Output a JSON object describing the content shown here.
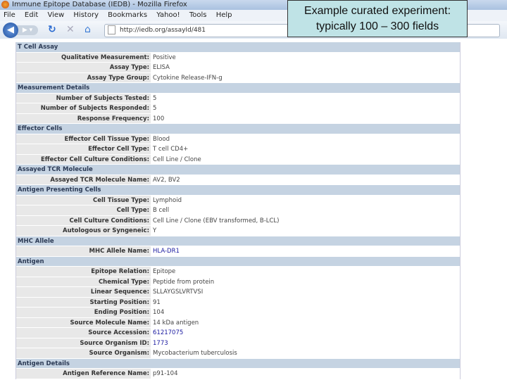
{
  "window_title": "Immune Epitope Database (IEDB) - Mozilla Firefox",
  "menu": [
    "File",
    "Edit",
    "View",
    "History",
    "Bookmarks",
    "Yahoo!",
    "Tools",
    "Help"
  ],
  "url": "http://iedb.org/assayId/481",
  "callout": {
    "line1": "Example curated experiment:",
    "line2": "typically 100 – 300 fields"
  },
  "sections": [
    {
      "title": "T Cell Assay",
      "rows": [
        {
          "label": "Qualitative Measurement:",
          "value": "Positive"
        },
        {
          "label": "Assay Type:",
          "value": "ELISA"
        },
        {
          "label": "Assay Type Group:",
          "value": "Cytokine Release-IFN-g"
        }
      ]
    },
    {
      "title": "Measurement Details",
      "rows": [
        {
          "label": "Number of Subjects Tested:",
          "value": "5"
        },
        {
          "label": "Number of Subjects Responded:",
          "value": "5"
        },
        {
          "label": "Response Frequency:",
          "value": "100"
        }
      ]
    },
    {
      "title": "Effector Cells",
      "rows": [
        {
          "label": "Effector Cell Tissue Type:",
          "value": "Blood"
        },
        {
          "label": "Effector Cell Type:",
          "value": "T cell CD4+"
        },
        {
          "label": "Effector Cell Culture Conditions:",
          "value": "Cell Line / Clone"
        }
      ]
    },
    {
      "title": "Assayed TCR Molecule",
      "rows": [
        {
          "label": "Assayed TCR Molecule Name:",
          "value": "AV2, BV2"
        }
      ]
    },
    {
      "title": "Antigen Presenting Cells",
      "rows": [
        {
          "label": "Cell Tissue Type:",
          "value": "Lymphoid"
        },
        {
          "label": "Cell Type:",
          "value": "B cell"
        },
        {
          "label": "Cell Culture Conditions:",
          "value": "Cell Line / Clone (EBV transformed, B-LCL)"
        },
        {
          "label": "Autologous or Syngeneic:",
          "value": "Y"
        }
      ]
    },
    {
      "title": "MHC Allele",
      "rows": [
        {
          "label": "MHC Allele Name:",
          "value": "HLA-DR1",
          "link": true
        }
      ]
    },
    {
      "title": "Antigen",
      "rows": [
        {
          "label": "Epitope Relation:",
          "value": "Epitope"
        },
        {
          "label": "Chemical Type:",
          "value": "Peptide from protein"
        },
        {
          "label": "Linear Sequence:",
          "value": "SLLAYGSLVRTVSI"
        },
        {
          "label": "Starting Position:",
          "value": "91"
        },
        {
          "label": "Ending Position:",
          "value": "104"
        },
        {
          "label": "Source Molecule Name:",
          "value": "14 kDa antigen"
        },
        {
          "label": "Source Accession:",
          "value": "61217075",
          "link": true
        },
        {
          "label": "Source Organism ID:",
          "value": "1773",
          "link": true
        },
        {
          "label": "Source Organism:",
          "value": "Mycobacterium tuberculosis"
        }
      ]
    },
    {
      "title": "Antigen Details",
      "rows": [
        {
          "label": "Antigen Reference Name:",
          "value": "p91-104"
        }
      ]
    }
  ]
}
